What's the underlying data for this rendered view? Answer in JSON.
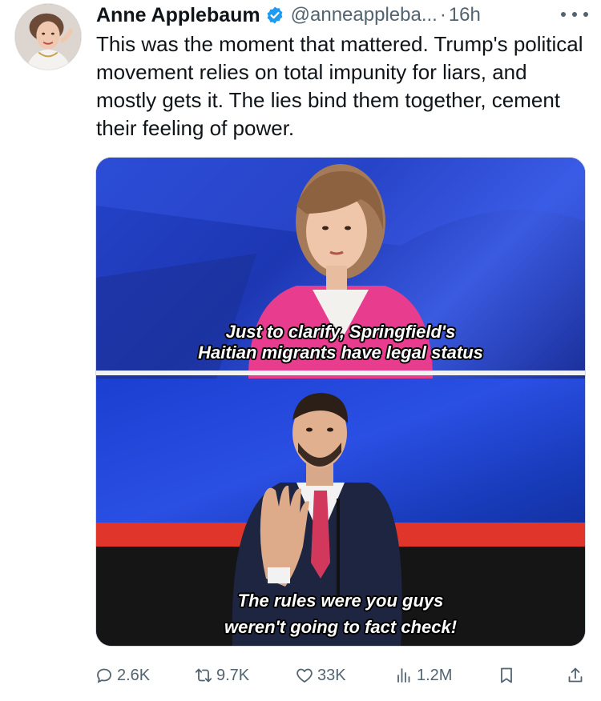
{
  "tweet": {
    "author_name": "Anne Applebaum",
    "handle": "@anneappleba...",
    "separator": "·",
    "time": "16h",
    "text": "This was the moment that mattered. Trump's political movement relies on total impunity for liars, and mostly gets it. The lies bind them together, cement their feeling of power."
  },
  "media": {
    "top_caption_line1": "Just to clarify, Springfield's",
    "top_caption_line2": "Haitian migrants have legal status",
    "bottom_caption_line1": "The rules were you guys",
    "bottom_caption_line2": "weren't going to fact check!"
  },
  "actions": {
    "replies": "2.6K",
    "reposts": "9.7K",
    "likes": "33K",
    "views": "1.2M"
  },
  "icons": [
    "verified-badge-icon",
    "more-dots-icon",
    "reply-icon",
    "repost-icon",
    "like-icon",
    "views-icon",
    "bookmark-icon",
    "share-icon"
  ],
  "colors": {
    "verified_blue": "#1d9bf0",
    "secondary_text": "#536471",
    "primary_text": "#0f1419"
  }
}
